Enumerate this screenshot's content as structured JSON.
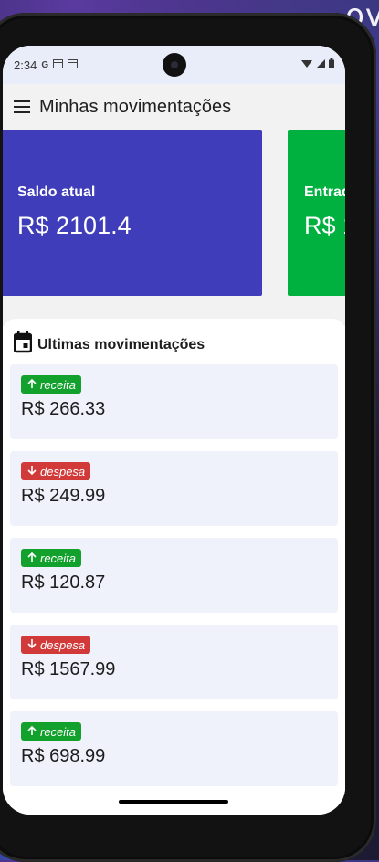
{
  "background": {
    "text": "ov"
  },
  "statusbar": {
    "time": "2:34",
    "left_icons": [
      "google-g-icon",
      "notification-icon",
      "notification-icon"
    ],
    "right_icons": [
      "wifi-icon",
      "signal-icon",
      "battery-icon"
    ]
  },
  "appbar": {
    "title": "Minhas movimentações"
  },
  "cards": {
    "saldo": {
      "label": "Saldo atual",
      "value": "R$ 2101.4",
      "color": "#3f3db9"
    },
    "entrada": {
      "label": "Entrad",
      "value": "R$ 1",
      "color": "#00b140"
    }
  },
  "list": {
    "title": "Ultimas movimentações",
    "items": [
      {
        "type": "receita",
        "amount": "R$ 266.33"
      },
      {
        "type": "despesa",
        "amount": "R$ 249.99"
      },
      {
        "type": "receita",
        "amount": "R$ 120.87"
      },
      {
        "type": "despesa",
        "amount": "R$ 1567.99"
      },
      {
        "type": "receita",
        "amount": "R$ 698.99"
      }
    ]
  },
  "colors": {
    "receita": "#13a12d",
    "despesa": "#d23a3a"
  }
}
